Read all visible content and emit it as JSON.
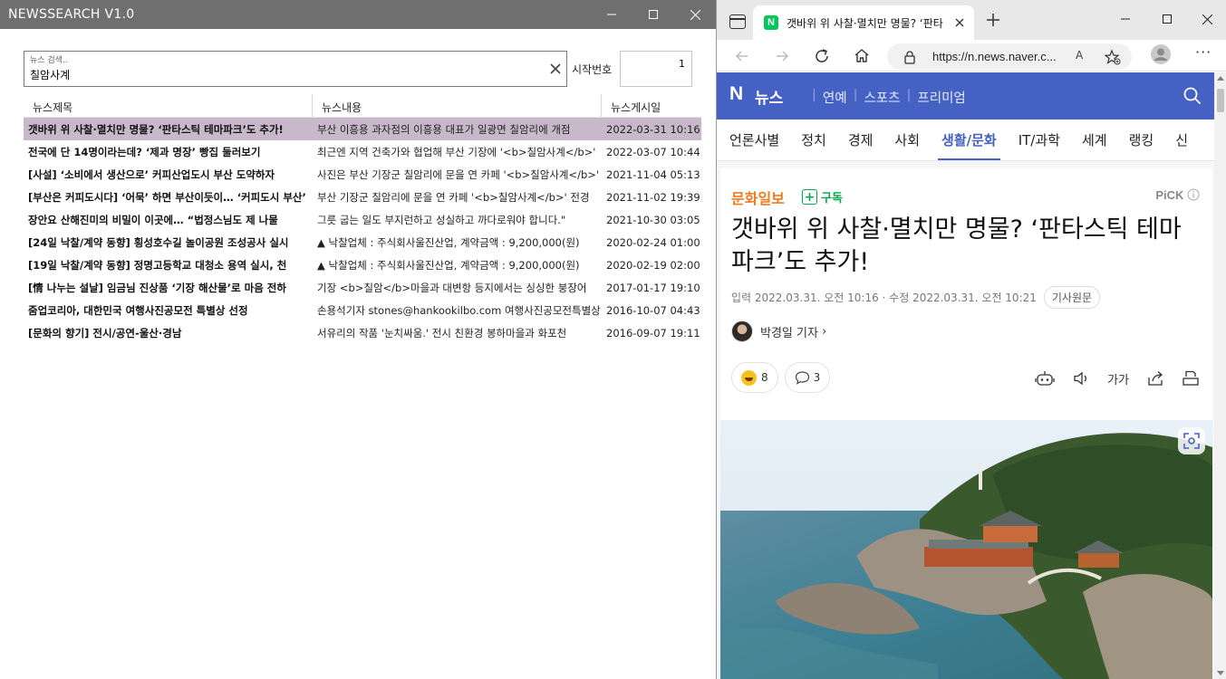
{
  "app": {
    "title": "NEWSSEARCH V1.0",
    "search": {
      "label": "뉴스 검색..",
      "value": "칠암사계"
    },
    "start": {
      "label": "시작번호",
      "value": "1"
    },
    "columns": [
      "뉴스제목",
      "뉴스내용",
      "뉴스게시일"
    ],
    "rows": [
      {
        "title": "갯바위 위 사찰·멸치만 명물? ‘판타스틱 테마파크’도 추가!",
        "content": "부산 이흥용 과자점의 이흥용 대표가 일광면 칠암리에 개점",
        "date": "2022-03-31 10:16",
        "selected": true
      },
      {
        "title": "전국에 단 14명이라는데? ‘제과 명장’ 빵집 둘러보기",
        "content": "최근엔 지역 건축가와 협업해 부산 기장에 '<b>칠암사계</b>'",
        "date": "2022-03-07 10:44",
        "selected": false
      },
      {
        "title": "[사설] ‘소비에서 생산으로’ 커피산업도시 부산 도약하자",
        "content": "사진은 부산 기장군 칠암리에 문을 연 카페 '<b>칠암사계</b>'",
        "date": "2021-11-04 05:13",
        "selected": false
      },
      {
        "title": "[부산은 커피도시다] ‘어묵’ 하면 부산이듯이… ‘커피도시 부산’",
        "content": "부산 기장군 칠암리에 문을 연 카페 '<b>칠암사계</b>' 전경",
        "date": "2021-11-02 19:39",
        "selected": false
      },
      {
        "title": "장안요 산해진미의 비밀이 이곳에… “법정스님도 제 나물",
        "content": "그릇 굽는 일도 부지런하고 성실하고 까다로워야 합니다.\"",
        "date": "2021-10-30 03:05",
        "selected": false
      },
      {
        "title": "[24일 낙찰/계약 동향] 횡성호수길 놀이공원 조성공사 실시",
        "content": "▲ 낙찰업체 : 주식회사울진산업, 계약금액 : 9,200,000(원)",
        "date": "2020-02-24 01:00",
        "selected": false
      },
      {
        "title": "[19일 낙찰/계약 동향] 정명고등학교 대청소 용역 실시, 천",
        "content": "▲ 낙찰업체 : 주식회사울진산업, 계약금액 : 9,200,000(원)",
        "date": "2020-02-19 02:00",
        "selected": false
      },
      {
        "title": "[情 나누는 설날] 임금님 진상품 ‘기장 해산물’로 마음 전하",
        "content": "기장 <b>칠암</b>마을과 대변항 등지에서는 싱싱한 붕장어",
        "date": "2017-01-17 19:10",
        "selected": false
      },
      {
        "title": "줌업코리아, 대한민국 여행사진공모전 특별상 선정",
        "content": "손용석기자 stones@hankookilbo.com 여행사진공모전특별상",
        "date": "2016-10-07 04:43",
        "selected": false
      },
      {
        "title": "[문화의 향기] 전시/공연-울산·경남",
        "content": "서유리의 작품 '눈치싸움.' 전시 친환경 봉하마을과 화포천",
        "date": "2016-09-07 19:11",
        "selected": false
      }
    ]
  },
  "browser": {
    "tab_title": "갯바위 위 사찰·멸치만 명물? ‘판타",
    "favicon_letter": "N",
    "url": "https://n.news.naver.c...",
    "read_aloud": "A",
    "naver": {
      "logo": "N",
      "news": "뉴스",
      "menu": [
        "연예",
        "스포츠",
        "프리미엄"
      ]
    },
    "sections": [
      "언론사별",
      "정치",
      "경제",
      "사회",
      "생활/문화",
      "IT/과학",
      "세계",
      "랭킹",
      "신"
    ],
    "article": {
      "press": "문화일보",
      "subscribe": "구독",
      "pick": "PiCK",
      "headline": "갯바위 위 사찰·멸치만 명물? ‘판타스틱 테마파크’도 추가!",
      "input_date": "입력 2022.03.31. 오전 10:16",
      "modify_date": "수정 2022.03.31. 오전 10:21",
      "original_button": "기사원문",
      "reporter": "박경일 기자",
      "reaction_count": "8",
      "comment_count": "3",
      "font_size_label": "가가"
    }
  },
  "colors": {
    "app_titlebar": "#6f6f6f",
    "selected_row": "#c9b8cc",
    "naver_blue": "#4561c3",
    "press_orange": "#f07b1e",
    "subscribe_green": "#03a94d"
  }
}
